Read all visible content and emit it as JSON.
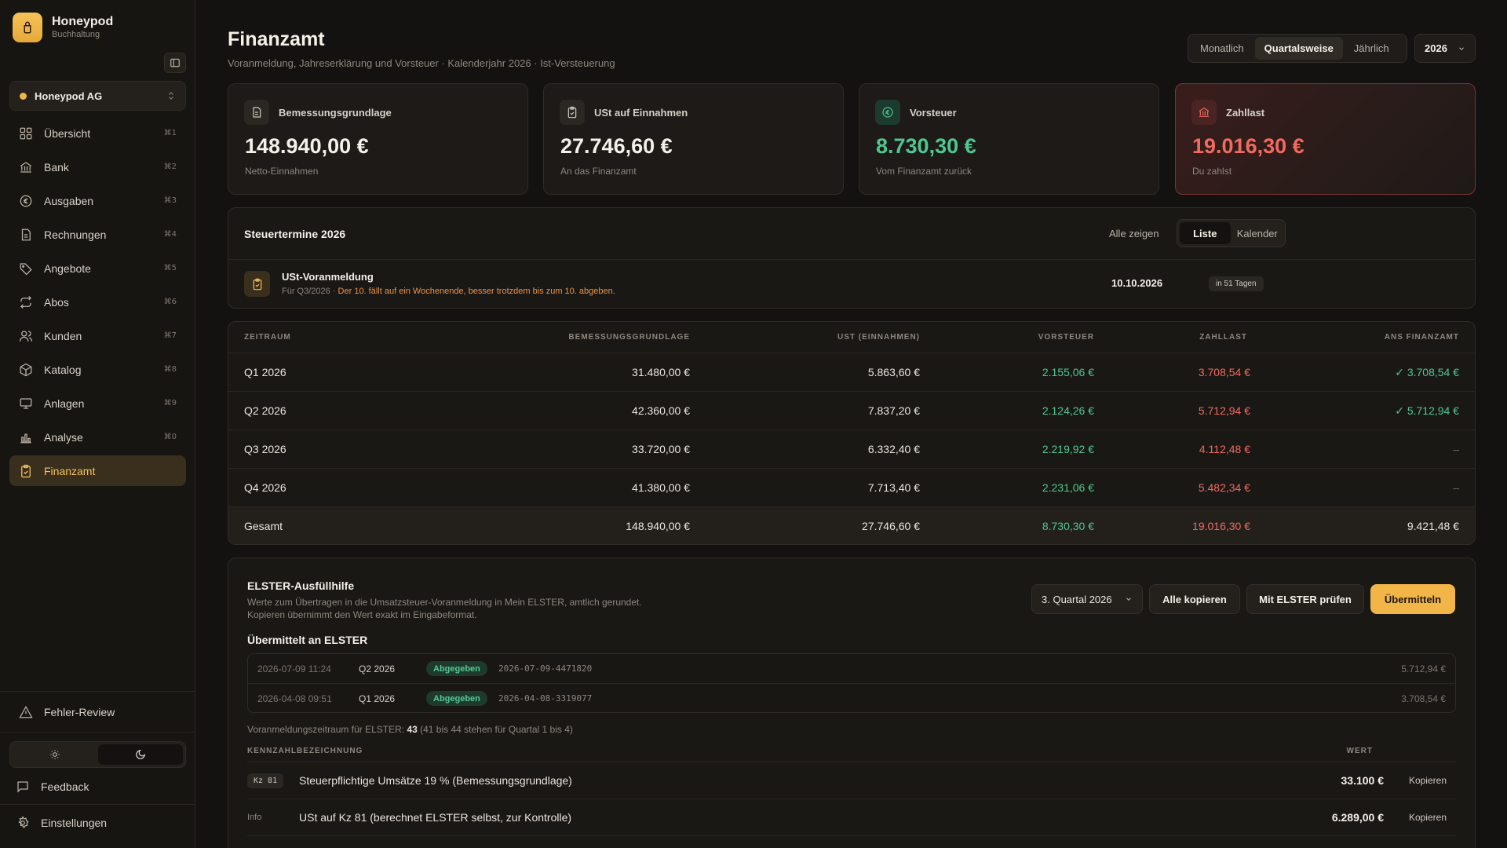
{
  "brand": {
    "name": "Honeypod",
    "subtitle": "Buchhaltung"
  },
  "org": {
    "name": "Honeypod AG"
  },
  "nav": [
    {
      "label": "Übersicht",
      "kbd": "⌘1",
      "icon": "grid-icon"
    },
    {
      "label": "Bank",
      "kbd": "⌘2",
      "icon": "bank-icon"
    },
    {
      "label": "Ausgaben",
      "kbd": "⌘3",
      "icon": "expense-icon"
    },
    {
      "label": "Rechnungen",
      "kbd": "⌘4",
      "icon": "invoice-icon"
    },
    {
      "label": "Angebote",
      "kbd": "⌘5",
      "icon": "tag-icon"
    },
    {
      "label": "Abos",
      "kbd": "⌘6",
      "icon": "repeat-icon"
    },
    {
      "label": "Kunden",
      "kbd": "⌘7",
      "icon": "users-icon"
    },
    {
      "label": "Katalog",
      "kbd": "⌘8",
      "icon": "box-icon"
    },
    {
      "label": "Anlagen",
      "kbd": "⌘9",
      "icon": "monitor-icon"
    },
    {
      "label": "Analyse",
      "kbd": "⌘0",
      "icon": "chart-icon"
    },
    {
      "label": "Finanzamt",
      "kbd": "",
      "icon": "clipboard-icon",
      "active": true
    }
  ],
  "sidebar_bottom": {
    "review": "Fehler-Review",
    "feedback": "Feedback",
    "settings": "Einstellungen"
  },
  "header": {
    "title": "Finanzamt",
    "subtitle": "Voranmeldung, Jahreserklärung und Vorsteuer · Kalenderjahr 2026 · Ist-Versteuerung",
    "periods": [
      "Monatlich",
      "Quartalsweise",
      "Jährlich"
    ],
    "active_period": "Quartalsweise",
    "year": "2026"
  },
  "kpis": [
    {
      "label": "Bemessungsgrundlage",
      "value": "148.940,00 €",
      "sub": "Netto-Einnahmen"
    },
    {
      "label": "USt auf Einnahmen",
      "value": "27.746,60 €",
      "sub": "An das Finanzamt"
    },
    {
      "label": "Vorsteuer",
      "value": "8.730,30 €",
      "sub": "Vom Finanzamt zurück"
    },
    {
      "label": "Zahllast",
      "value": "19.016,30 €",
      "sub": "Du zahlst"
    }
  ],
  "termine": {
    "title": "Steuertermine 2026",
    "show_all": "Alle zeigen",
    "views": [
      "Liste",
      "Kalender"
    ],
    "item": {
      "name": "USt-Voranmeldung",
      "period": "Für Q3/2026 · ",
      "warning": "Der 10. fällt auf ein Wochenende, besser trotzdem bis zum 10. abgeben.",
      "date": "10.10.2026",
      "badge": "in 51 Tagen"
    }
  },
  "table": {
    "headers": [
      "ZEITRAUM",
      "BEMESSUNGSGRUNDLAGE",
      "UST (EINNAHMEN)",
      "VORSTEUER",
      "ZAHLLAST",
      "ANS FINANZAMT"
    ],
    "rows": [
      [
        "Q1 2026",
        "31.480,00 €",
        "5.863,60 €",
        "2.155,06 €",
        "3.708,54 €",
        "✓ 3.708,54 €"
      ],
      [
        "Q2 2026",
        "42.360,00 €",
        "7.837,20 €",
        "2.124,26 €",
        "5.712,94 €",
        "✓ 5.712,94 €"
      ],
      [
        "Q3 2026",
        "33.720,00 €",
        "6.332,40 €",
        "2.219,92 €",
        "4.112,48 €",
        "–"
      ],
      [
        "Q4 2026",
        "41.380,00 €",
        "7.713,40 €",
        "2.231,06 €",
        "5.482,34 €",
        "–"
      ]
    ],
    "total": [
      "Gesamt",
      "148.940,00 €",
      "27.746,60 €",
      "8.730,30 €",
      "19.016,30 €",
      "9.421,48 €"
    ]
  },
  "elster": {
    "title": "ELSTER-Ausfüllhilfe",
    "desc1": "Werte zum Übertragen in die Umsatzsteuer-Voranmeldung in Mein ELSTER, amtlich gerundet.",
    "desc2": "Kopieren übernimmt den Wert exakt im Eingabeformat.",
    "quarter": "3. Quartal 2026",
    "copy_all": "Alle kopieren",
    "check": "Mit ELSTER prüfen",
    "submit": "Übermitteln",
    "submitted_title": "Übermittelt an ELSTER",
    "submissions": [
      {
        "date": "2026-07-09 11:24",
        "quarter": "Q2 2026",
        "status": "Abgegeben",
        "id": "2026-07-09-4471820",
        "amount": "5.712,94 €"
      },
      {
        "date": "2026-04-08 09:51",
        "quarter": "Q1 2026",
        "status": "Abgegeben",
        "id": "2026-04-08-3319077",
        "amount": "3.708,54 €"
      }
    ],
    "period_prefix": "Voranmeldungszeitraum für ELSTER: ",
    "period_value": "43",
    "period_suffix": " (41 bis 44 stehen für Quartal 1 bis 4)",
    "kz_headers": [
      "KENNZAHLBEZEICHNUNG",
      "WERT"
    ],
    "kz_rows": [
      {
        "tag": "Kz 81",
        "label": "Steuerpflichtige Umsätze 19 % (Bemessungsgrundlage)",
        "value": "33.100 €",
        "copy": "Kopieren"
      },
      {
        "tag": "Info",
        "label": "USt auf Kz 81 (berechnet ELSTER selbst, zur Kontrolle)",
        "value": "6.289,00 €",
        "copy": "Kopieren"
      }
    ]
  },
  "colors": {
    "accent": "#f2b648",
    "positive": "#4fc78f",
    "negative": "#f06a5f"
  }
}
